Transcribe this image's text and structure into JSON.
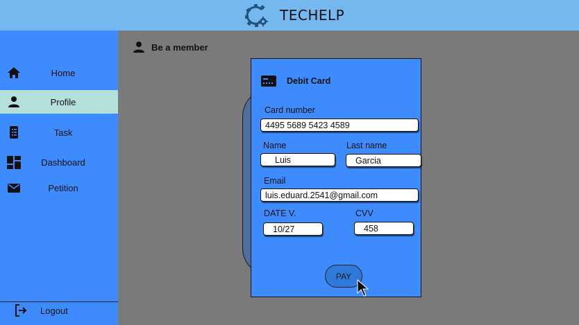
{
  "app": {
    "name": "TECHELP"
  },
  "sidebar": {
    "items": [
      {
        "label": "Home",
        "icon": "home-icon"
      },
      {
        "label": "Profile",
        "icon": "person-icon",
        "active": true
      },
      {
        "label": "Task",
        "icon": "clipboard-icon"
      },
      {
        "label": "Dashboard",
        "icon": "dashboard-icon"
      },
      {
        "label": "Petition",
        "icon": "mail-icon"
      }
    ],
    "logout": {
      "label": "Logout",
      "icon": "logout-icon"
    }
  },
  "main": {
    "title": "Be a member"
  },
  "card": {
    "title": "Debit Card",
    "card_number": {
      "label": "Card number",
      "value": "4495 5689 5423 4589"
    },
    "name": {
      "label": "Name",
      "value": "Luis"
    },
    "last_name": {
      "label": "Last name",
      "value": "Garcia"
    },
    "email": {
      "label": "Email",
      "value": "luis.eduard.2541@gmail.com"
    },
    "date": {
      "label": "DATE V.",
      "value": "10/27"
    },
    "cvv": {
      "label": "CVV",
      "value": "458"
    },
    "pay_label": "PAY"
  },
  "colors": {
    "topbar": "#75b7ef",
    "sidebar": "#3e8bfe",
    "active_item": "#b4e0dc",
    "card": "#3d8bfd",
    "backdrop": "#7a7a7a",
    "pay_button": "#2f7ad9"
  }
}
